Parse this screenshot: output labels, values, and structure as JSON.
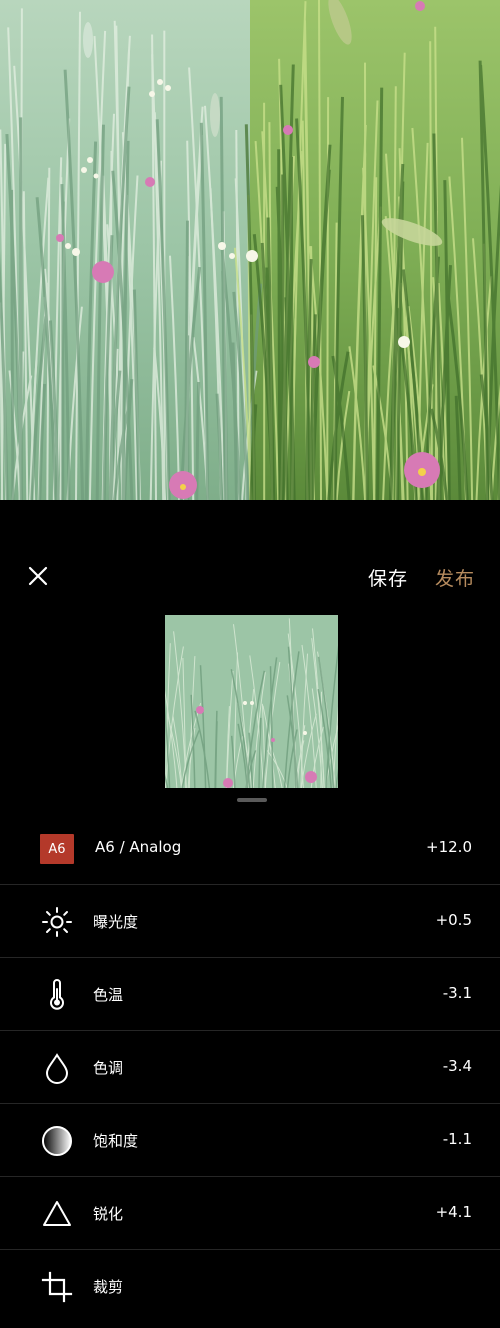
{
  "header": {
    "save_label": "保存",
    "publish_label": "发布"
  },
  "colors": {
    "background": "#000000",
    "publish_accent": "#b68b5e",
    "preset_badge": "#b4392a",
    "divider": "#262626",
    "filtered_green": "#9cc5a6",
    "original_green": "#7fae55",
    "flower_pink": "#d96db0"
  },
  "preset": {
    "badge": "A6",
    "label": "A6 / Analog",
    "value": "+12.0"
  },
  "adjustments": [
    {
      "icon": "sun-icon",
      "label": "曝光度",
      "value": "+0.5"
    },
    {
      "icon": "thermometer-icon",
      "label": "色温",
      "value": "-3.1"
    },
    {
      "icon": "droplet-icon",
      "label": "色调",
      "value": "-3.4"
    },
    {
      "icon": "saturation-gradient-icon",
      "label": "饱和度",
      "value": "-1.1"
    },
    {
      "icon": "triangle-icon",
      "label": "锐化",
      "value": "+4.1"
    },
    {
      "icon": "crop-icon",
      "label": "裁剪",
      "value": ""
    }
  ]
}
